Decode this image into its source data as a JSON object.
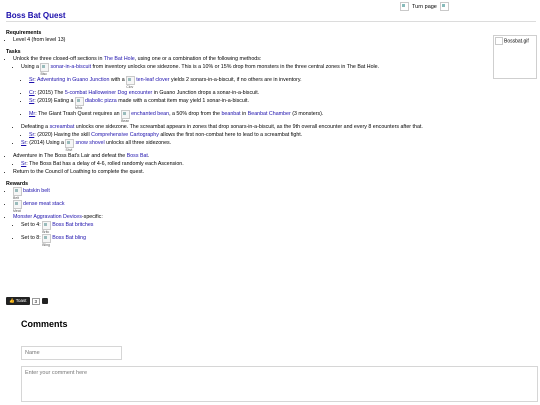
{
  "top": {
    "turn_page": "Turn page"
  },
  "title": "Boss Bat Quest",
  "sidebar_image": "Bossbat.gif",
  "requirements": {
    "header": "Requirements",
    "items": [
      "Level 4 (from level 13)"
    ]
  },
  "tasks": {
    "header": "Tasks",
    "intro_pre": "Unlock the three closed-off sections in ",
    "intro_link": "The Bat Hole",
    "intro_post": ", using one or a combination of the following methods:",
    "sonar": {
      "pre": "Using a ",
      "img_cap": "Bisc",
      "link": "sonar-in-a-biscuit",
      "post": " from inventory unlocks one sidezone. This is a 10% or 15% drop from monsters in the three central zones in The Bat Hole."
    },
    "sub": [
      {
        "tag": "Sr",
        "pre": ": ",
        "link1": "Adventuring in Guano Junction",
        "mid": " with a ",
        "img_cap": "Clov",
        "link2": "ten-leaf clover",
        "post": " yields 2 sonars-in-a-biscuit, if no others are in inventory."
      },
      {
        "tag": "Cr",
        "pre": ": (2015) The ",
        "link1": "5-combat Halloweiner Dog encounter",
        "post": " in Guano Junction drops a sonar-in-a-biscuit."
      },
      {
        "tag": "Sr",
        "pre": ": (2019) Eating a ",
        "img_cap": "Mhiz",
        "link1": "diabolic pizza",
        "post": " made with a combat item may yield 1 sonar-in-a-biscuit."
      },
      {
        "tag": "Mr",
        "pre": ": The Giant Trash Quest requires an ",
        "img_cap": "Bean",
        "link1": "enchanted bean",
        "mid": ", a 50% drop from the ",
        "link2": "beanbat",
        "mid2": " in ",
        "link3": "Beanbat Chamber",
        "post": " (3 monsters)."
      }
    ],
    "screambat": {
      "pre": "Defeating a ",
      "link": "screambat",
      "post": " unlocks one sidezone. The screambat appears in zones that drop sonars-in-a-biscuit, as the 9th overall encounter and every 8 encounters after that."
    },
    "screambat_sub": {
      "tag": "Sr",
      "pre": ": (2020) Having the skill ",
      "link": "Comprehensive Cartography",
      "post": " allows the first non-combat here to lead to a screambat fight."
    },
    "shovel": {
      "tag": "Sr",
      "pre": ": (2014) Using a ",
      "img_cap": "Shvl",
      "link": "snow shovel",
      "post": " unlocks all three sidezones."
    },
    "lair": {
      "pre": "Adventure in The Boss Bat's Lair and defeat the ",
      "link": "Boss Bat",
      "post": "."
    },
    "lair_sub": {
      "tag": "Sr",
      "pre": ": The Boss Bat has a delay of 4-6, rolled randomly each Ascension."
    },
    "return": "Return to the Council of Loathing to complete the quest."
  },
  "rewards": {
    "header": "Rewards",
    "items": [
      {
        "img_cap": "Belt",
        "label": "batskin belt"
      },
      {
        "img_cap": "Meat",
        "label": "dense meat stack"
      }
    ],
    "mad": {
      "link": "Monster Aggravation Devices",
      "post": "-specific:"
    },
    "mad_items": [
      {
        "pre": "Set to 4: ",
        "img_cap": "Britc",
        "label": "Boss Bat britches"
      },
      {
        "pre": "Set to 8: ",
        "img_cap": "Bling",
        "label": "Boss Bat bling"
      }
    ]
  },
  "toast": {
    "label": "Toast",
    "count": "3"
  },
  "comments": {
    "header": "Comments",
    "name_placeholder": "Name",
    "comment_placeholder": "Enter your comment here"
  }
}
